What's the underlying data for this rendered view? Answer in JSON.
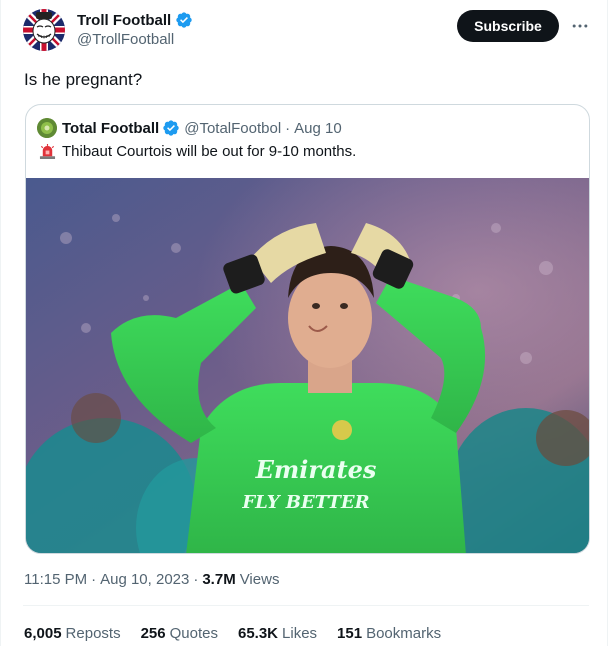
{
  "author": {
    "name": "Troll Football",
    "handle": "@TrollFootball",
    "verified": true
  },
  "subscribe_label": "Subscribe",
  "more_icon": "more-dots-icon",
  "tweet_text": "Is he pregnant?",
  "quoted": {
    "name": "Total Football",
    "handle": "@TotalFootbol",
    "separator": "·",
    "date": "Aug 10",
    "text": "Thibaut Courtois will be out for 9-10 months.",
    "emoji_icon": "siren-icon",
    "image_jersey_text": [
      "Emirates",
      "FLY BETTER"
    ]
  },
  "meta": {
    "time": "11:15 PM",
    "separator": "·",
    "date": "Aug 10, 2023",
    "views_count": "3.7M",
    "views_label": "Views"
  },
  "stats": [
    {
      "count": "6,005",
      "label": "Reposts"
    },
    {
      "count": "256",
      "label": "Quotes"
    },
    {
      "count": "65.3K",
      "label": "Likes"
    },
    {
      "count": "151",
      "label": "Bookmarks"
    }
  ],
  "colors": {
    "verified_blue": "#1d9bf0",
    "text_primary": "#0f1419",
    "text_secondary": "#536471",
    "button_dark": "#0f1419",
    "kit_green": "#3bd55a"
  }
}
